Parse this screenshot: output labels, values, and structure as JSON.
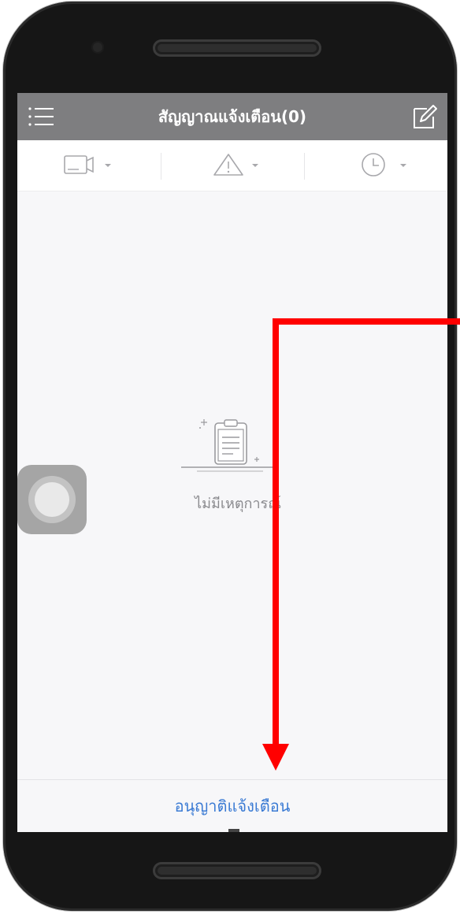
{
  "header": {
    "title": "สัญญาณแจ้งเตือน(0)",
    "menu_icon": "hamburger-menu-icon",
    "edit_icon": "edit-pencil-icon"
  },
  "filters": [
    {
      "icon": "camera-icon"
    },
    {
      "icon": "warning-triangle-icon"
    },
    {
      "icon": "clock-icon"
    }
  ],
  "empty_state": {
    "icon": "clipboard-icon",
    "message": "ไม่มีเหตุการณ์"
  },
  "footer": {
    "allow_label": "อนุญาติแจ้งเตือน"
  },
  "colors": {
    "header_bg": "#7e7e80",
    "link_blue": "#3b7bd4",
    "annotation_red": "#ff0000",
    "screen_bg": "#f7f7f9"
  }
}
